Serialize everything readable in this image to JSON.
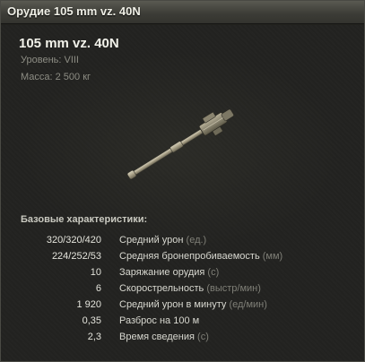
{
  "window": {
    "title": "Орудие 105 mm vz. 40N"
  },
  "gun": {
    "name": "105 mm vz. 40N",
    "level_text": "Уровень: VIII",
    "mass_text": "Масса: 2 500 кг",
    "image_icon": "gun-barrel-icon"
  },
  "stats": {
    "section_title": "Базовые характеристики:",
    "rows": [
      {
        "value": "320/320/420",
        "label": "Средний урон",
        "unit": "(ед.)"
      },
      {
        "value": "224/252/53",
        "label": "Средняя бронепробиваемость",
        "unit": "(мм)"
      },
      {
        "value": "10",
        "label": "Заряжание орудия",
        "unit": "(с)"
      },
      {
        "value": "6",
        "label": "Скорострельность",
        "unit": "(выстр/мин)"
      },
      {
        "value": "1 920",
        "label": "Средний урон в минуту",
        "unit": "(ед/мин)"
      },
      {
        "value": "0,35",
        "label": "Разброс на 100 м",
        "unit": ""
      },
      {
        "value": "2,3",
        "label": "Время сведения",
        "unit": "(с)"
      }
    ]
  }
}
